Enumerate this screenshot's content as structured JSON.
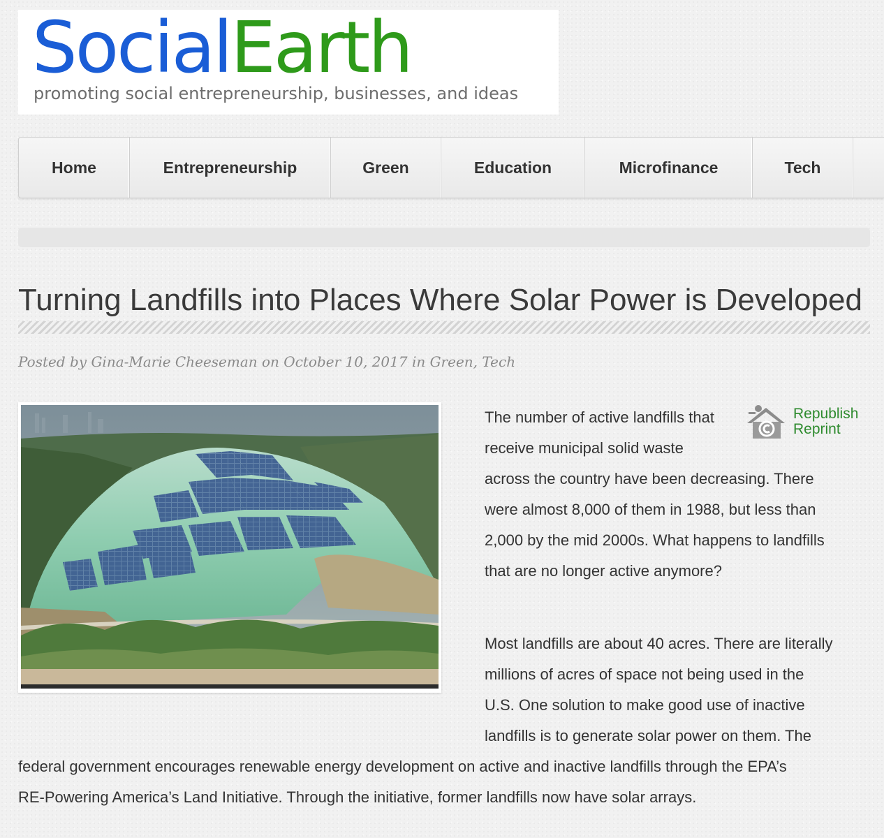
{
  "logo": {
    "title_part1": "Social",
    "title_part2": "Earth",
    "tagline": "promoting social entrepreneurship, businesses, and ideas",
    "color_social": "#1a5dd6",
    "color_earth": "#2e9a1a"
  },
  "nav": {
    "items": [
      {
        "label": "Home"
      },
      {
        "label": "Entrepreneurship"
      },
      {
        "label": "Green"
      },
      {
        "label": "Education"
      },
      {
        "label": "Microfinance"
      },
      {
        "label": "Tech"
      }
    ]
  },
  "article": {
    "title": "Turning Landfills into Places Where Solar Power is Developed",
    "meta": "Posted by Gina-Marie Cheeseman on October 10, 2017 in Green, Tech",
    "image_icon": "solar-landfill-photo",
    "republish": {
      "icon": "republish-house-copyright-icon",
      "label_1": "Republish",
      "label_2": "Reprint",
      "color": "#2e8b2e"
    },
    "p1": {
      "line1": "The number of active landfills that",
      "line2": "receive municipal solid waste",
      "line3": "across the country have been decreasing. There",
      "line4": "were almost 8,000 of them in 1988, but less than",
      "line5": "2,000 by the mid 2000s. What happens to landfills",
      "line6": "that are no longer active anymore?"
    },
    "p2": {
      "line1": "Most landfills are about 40 acres. There are literally",
      "line2": "millions of acres of space not being used in the",
      "line3": "U.S. One solution to make good use of inactive",
      "line4": "landfills is to generate solar power on them. The",
      "line5": "federal government encourages renewable energy development on active and inactive landfills through the EPA’s",
      "line6": "RE-Powering America’s Land Initiative. Through the initiative, former landfills now have solar arrays."
    }
  }
}
